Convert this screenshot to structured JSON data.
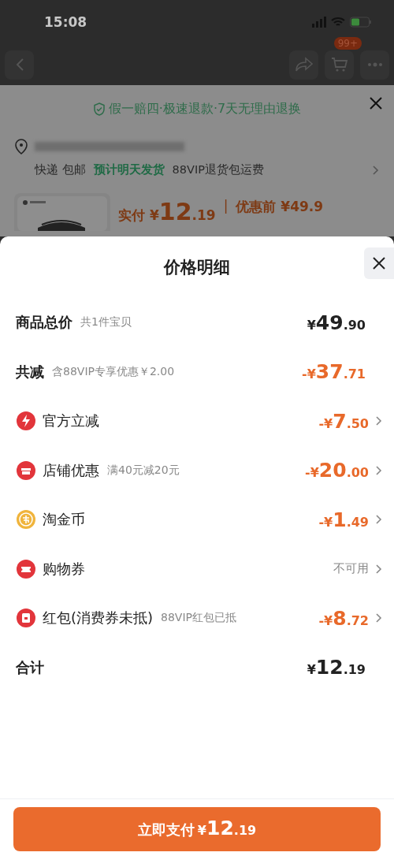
{
  "status_bar": {
    "time": "15:08"
  },
  "nav": {
    "cart_badge": "99+"
  },
  "behind": {
    "guarantee": "假一赔四·极速退款·7天无理由退换",
    "shipping": [
      {
        "text": "快递 包邮",
        "kind": "plain"
      },
      {
        "text": "预计明天发货",
        "kind": "green"
      },
      {
        "text": "88VIP退货包运费",
        "kind": "plain"
      }
    ],
    "paid_label": "实付",
    "paid_currency": "¥",
    "paid_whole": "12",
    "paid_cents": ".19",
    "separator": "|",
    "before_label": "优惠前",
    "before_price": "¥49.9"
  },
  "sheet": {
    "title": "价格明细",
    "rows": [
      {
        "kind": "summary",
        "label": "商品总价",
        "note": "共1件宝贝",
        "highlight": false,
        "has_detail": false,
        "amount": {
          "currency": "¥",
          "whole": "49",
          "cents": ".90"
        }
      },
      {
        "kind": "summary",
        "label": "共减",
        "note": "含88VIP专享优惠￥2.00",
        "highlight": true,
        "has_detail": false,
        "amount": {
          "currency": "-¥",
          "whole": "37",
          "cents": ".71"
        }
      },
      {
        "kind": "discount",
        "color": "#e2353b",
        "label": "官方立减",
        "highlight": true,
        "has_detail": true,
        "amount": {
          "currency": "-¥",
          "whole": "7",
          "cents": ".50"
        }
      },
      {
        "kind": "discount",
        "color": "#e2353b",
        "label": "店铺优惠",
        "note": "满40元减20元",
        "highlight": true,
        "has_detail": true,
        "amount": {
          "currency": "-¥",
          "whole": "20",
          "cents": ".00"
        }
      },
      {
        "kind": "discount",
        "color": "#f0b43c",
        "label": "淘金币",
        "highlight": true,
        "has_detail": true,
        "amount": {
          "currency": "-¥",
          "whole": "1",
          "cents": ".49"
        }
      },
      {
        "kind": "discount",
        "color": "#e2353b",
        "label": "购物券",
        "highlight": false,
        "has_detail": true,
        "status": "不可用"
      },
      {
        "kind": "discount",
        "color": "#e2353b",
        "label": "红包(消费券未抵)",
        "note": "88VIP红包已抵",
        "highlight": true,
        "has_detail": true,
        "amount": {
          "currency": "-¥",
          "whole": "8",
          "cents": ".72"
        }
      },
      {
        "kind": "summary",
        "label": "合计",
        "highlight": false,
        "has_detail": false,
        "amount": {
          "currency": "¥",
          "whole": "12",
          "cents": ".19"
        }
      }
    ],
    "pay_button": {
      "label": "立即支付",
      "currency": "¥",
      "whole": "12",
      "cents": ".19"
    }
  }
}
